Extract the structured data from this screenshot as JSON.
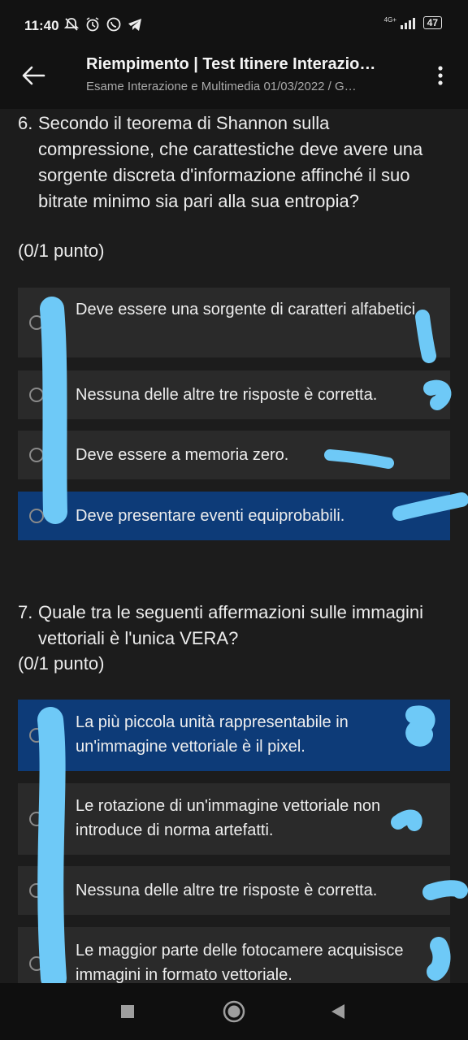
{
  "status_bar": {
    "time": "11:40",
    "network_label": "4G+",
    "battery": "47",
    "icons": [
      "mute-icon",
      "alarm-icon",
      "whatsapp-icon",
      "telegram-icon"
    ]
  },
  "app_bar": {
    "title": "Riempimento | Test Itinere Interazio…",
    "subtitle": "Esame Interazione e Multimedia 01/03/2022 / G…"
  },
  "questions": [
    {
      "number": "6.",
      "text": "Secondo il teorema di Shannon sulla compressione, che carattestiche deve avere una sorgente discreta d'informazione affinché il suo bitrate minimo sia pari alla sua entropia?",
      "points": "(0/1 punto)",
      "options": [
        {
          "label": "Deve essere una sorgente di caratteri alfabetici.",
          "selected": false
        },
        {
          "label": "Nessuna delle altre tre risposte è corretta.",
          "selected": false
        },
        {
          "label": "Deve essere a memoria zero.",
          "selected": false
        },
        {
          "label": "Deve presentare eventi equiprobabili.",
          "selected": true
        }
      ]
    },
    {
      "number": "7.",
      "text": "Quale tra le seguenti affermazioni sulle immagini vettoriali è l'unica VERA?",
      "points": "(0/1 punto)",
      "options": [
        {
          "label": "La più piccola unità rappresentabile in un'immagine vettoriale è il pixel.",
          "selected": true
        },
        {
          "label": "Le rotazione di un'immagine vettoriale non introduce di norma artefatti.",
          "selected": false
        },
        {
          "label": "Nessuna delle altre tre risposte è corretta.",
          "selected": false
        },
        {
          "label": "Le maggior parte delle fotocamere acquisisce immagini in formato vettoriale.",
          "selected": false
        }
      ]
    }
  ],
  "colors": {
    "background": "#1c1c1c",
    "option_bg": "#2a2a2a",
    "selected_bg": "#0d3b78",
    "annotation": "#6ec9f7"
  }
}
